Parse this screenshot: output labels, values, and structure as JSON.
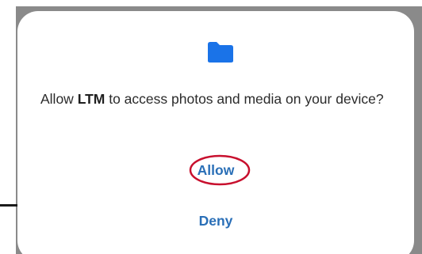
{
  "dialog": {
    "icon": "folder-icon",
    "message_prefix": "Allow ",
    "app_name": "LTM",
    "message_suffix": " to access photos and media on your device?",
    "allow_label": "Allow",
    "deny_label": "Deny"
  },
  "colors": {
    "accent": "#2a6fb7",
    "folder": "#1a73e8",
    "annotation": "#c8102e",
    "scrim": "#8a8a8a"
  }
}
